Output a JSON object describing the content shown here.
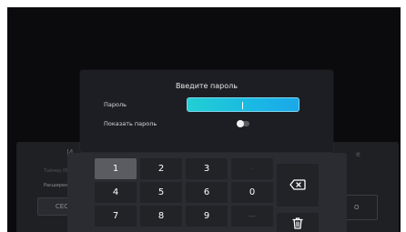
{
  "background_panel": {
    "title_partial": "И",
    "title_right_partial": "е",
    "row1_partial": "Таймер 06",
    "row2_partial": "Расширен",
    "cec_button": "CEC",
    "right_value_partial": "О"
  },
  "dialog": {
    "title": "Введите пароль",
    "password_label": "Пароль",
    "password_value": "",
    "show_password_label": "Показать пароль",
    "show_password_enabled": false
  },
  "keyboard": {
    "keys": {
      "k1": "1",
      "k2": "2",
      "k3": "3",
      "k_dot": "·",
      "k4": "4",
      "k5": "5",
      "k6": "6",
      "k0": "0",
      "k7": "7",
      "k8": "8",
      "k9": "9",
      "k_dash": "—"
    },
    "focused_key": "1",
    "icons": {
      "backspace": "backspace-icon",
      "delete": "trash-icon"
    }
  },
  "colors": {
    "accent_field_start": "#22cfd2",
    "accent_field_end": "#1ba8ea",
    "dialog_bg": "#1d1e23",
    "screen_bg": "#0b0b0d"
  }
}
